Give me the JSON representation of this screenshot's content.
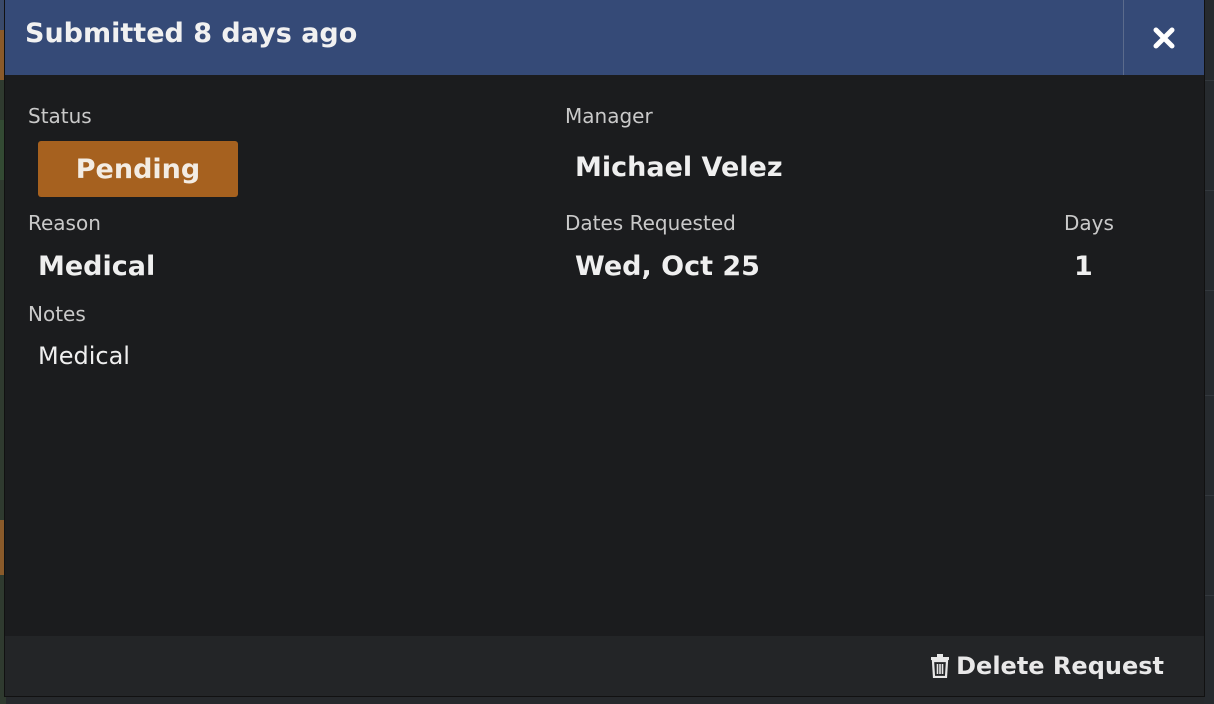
{
  "modal": {
    "title": "Submitted 8 days ago",
    "close_icon": "close-icon"
  },
  "fields": {
    "status_label": "Status",
    "status_value": "Pending",
    "manager_label": "Manager",
    "manager_value": "Michael Velez",
    "reason_label": "Reason",
    "reason_value": "Medical",
    "dates_label": "Dates Requested",
    "dates_value": "Wed, Oct 25",
    "days_label": "Days",
    "days_value": "1",
    "notes_label": "Notes",
    "notes_value": "Medical"
  },
  "footer": {
    "delete_label": "Delete Request",
    "delete_icon": "trash-icon"
  },
  "colors": {
    "header_bg": "#354a77",
    "status_badge_bg": "#a6611f",
    "modal_bg": "#1b1c1e",
    "footer_bg": "#232527"
  }
}
